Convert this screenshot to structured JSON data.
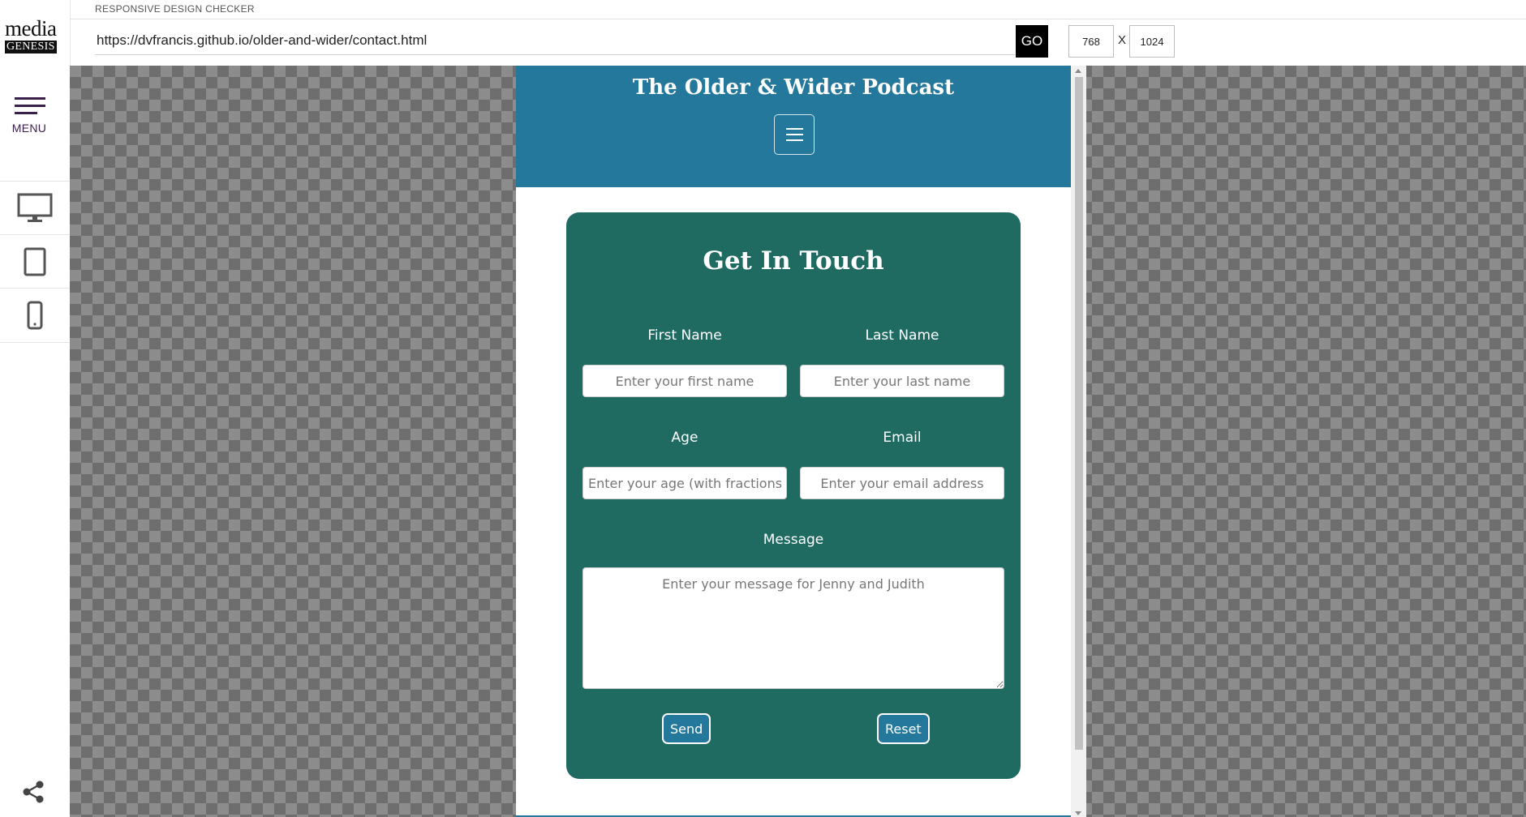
{
  "app": {
    "label": "RESPONSIVE DESIGN CHECKER",
    "logo_top": "media",
    "logo_bottom": "GENESIS",
    "menu_label": "MENU",
    "url": "https://dvfrancis.github.io/older-and-wider/contact.html",
    "go_label": "GO",
    "width_value": "768",
    "height_value": "1024",
    "dim_separator": "X",
    "devices": [
      "desktop-icon",
      "tablet-icon",
      "phone-icon"
    ]
  },
  "site": {
    "title": "The Older & Wider Podcast",
    "header_color": "#24789c",
    "card_color": "#1f6b62"
  },
  "form": {
    "title": "Get In Touch",
    "first_name_label": "First Name",
    "first_name_placeholder": "Enter your first name",
    "last_name_label": "Last Name",
    "last_name_placeholder": "Enter your last name",
    "age_label": "Age",
    "age_placeholder": "Enter your age (with fractions)",
    "email_label": "Email",
    "email_placeholder": "Enter your email address",
    "message_label": "Message",
    "message_placeholder": "Enter your message for Jenny and Judith",
    "send_label": "Send",
    "reset_label": "Reset"
  }
}
